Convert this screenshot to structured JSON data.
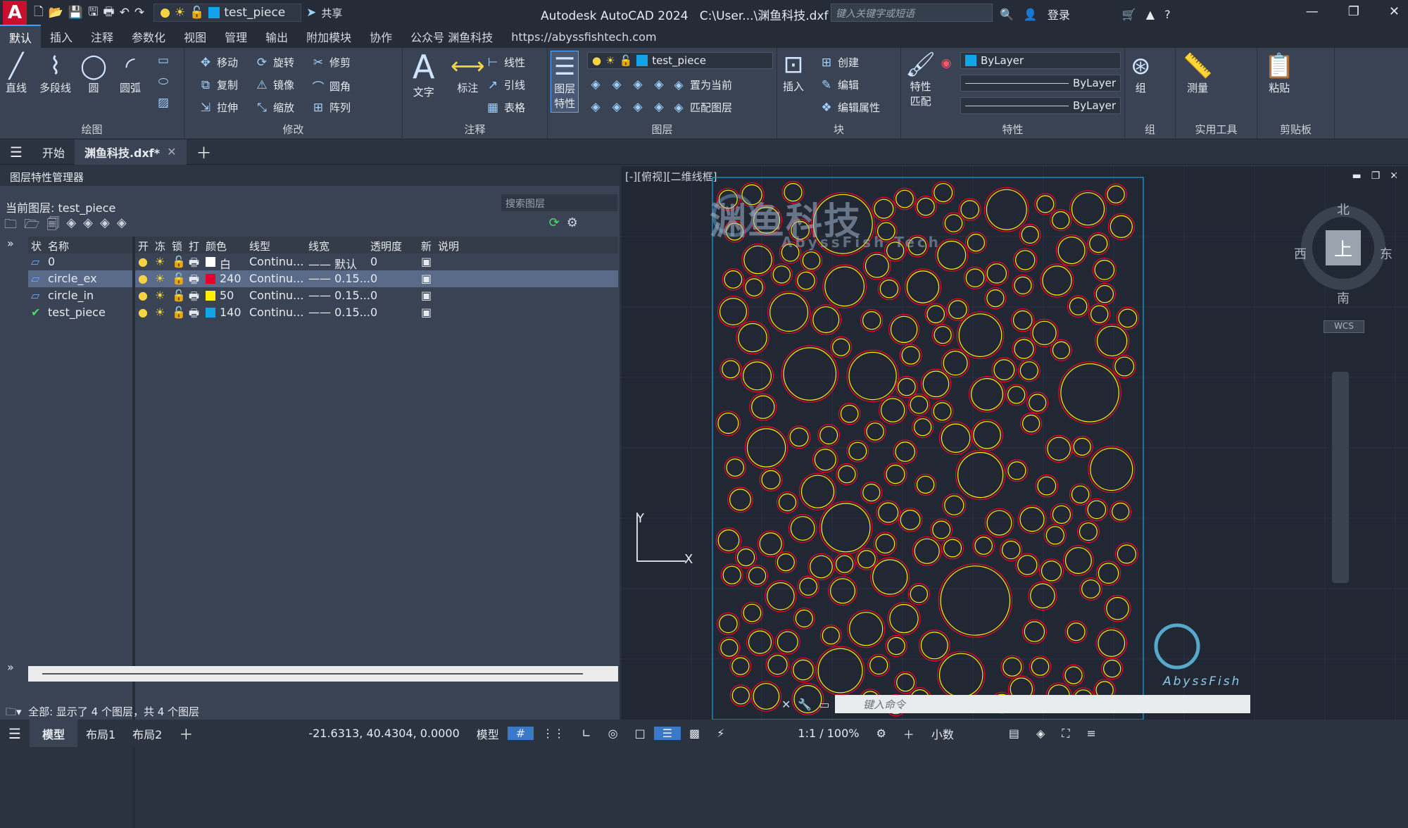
{
  "app": {
    "logo": "A",
    "title": "Autodesk AutoCAD 2024",
    "file_path": "C:\\User...\\渊鱼科技.dxf",
    "search_placeholder": "键入关键字或短语",
    "login": "登录",
    "share": "共享"
  },
  "quick_access": {
    "layer": "test_piece",
    "layer_color": "#12a4e8"
  },
  "menu": [
    "默认",
    "插入",
    "注释",
    "参数化",
    "视图",
    "管理",
    "输出",
    "附加模块",
    "协作",
    "公众号 渊鱼科技",
    "https://abyssfishtech.com"
  ],
  "ribbon": {
    "draw": {
      "title": "绘图",
      "line": "直线",
      "polyline": "多段线",
      "circle": "圆",
      "arc": "圆弧"
    },
    "modify": {
      "title": "修改",
      "move": "移动",
      "rotate": "旋转",
      "trim": "修剪",
      "copy": "复制",
      "mirror": "镜像",
      "fillet": "圆角",
      "stretch": "拉伸",
      "scale": "缩放",
      "array": "阵列"
    },
    "annotation": {
      "title": "注释",
      "text": "文字",
      "dimension": "标注",
      "linear": "线性",
      "leader": "引线",
      "table": "表格"
    },
    "layers": {
      "title": "图层",
      "props_line1": "图层",
      "props_line2": "特性",
      "current_layer": "test_piece",
      "set_current": "置为当前",
      "match_layer": "匹配图层"
    },
    "block": {
      "title": "块",
      "insert": "插入",
      "create": "创建",
      "edit": "编辑",
      "edit_attr": "编辑属性"
    },
    "properties": {
      "title": "特性",
      "match_line1": "特性",
      "match_line2": "匹配",
      "color": "ByLayer",
      "linetype": "ByLayer",
      "lineweight": "ByLayer"
    },
    "groups": {
      "title": "组",
      "group": "组"
    },
    "utilities": {
      "title": "实用工具",
      "measure": "测量"
    },
    "clipboard": {
      "title": "剪贴板",
      "paste": "粘贴"
    }
  },
  "doc_tabs": {
    "start": "开始",
    "file": "渊鱼科技.dxf*"
  },
  "layer_manager": {
    "title": "图层特性管理器",
    "current": "当前图层: test_piece",
    "search_placeholder": "搜索图层",
    "columns": [
      "状",
      "名称",
      "开",
      "冻",
      "锁",
      "打",
      "颜色",
      "线型",
      "线宽",
      "透明度",
      "新",
      "说明"
    ],
    "rows": [
      {
        "name": "0",
        "color_name": "白",
        "color": "#ffffff",
        "linetype": "Continu...",
        "lineweight": "默认",
        "transparency": "0",
        "selected": false,
        "current": false
      },
      {
        "name": "circle_ex",
        "color_name": "240",
        "color": "#e8002a",
        "linetype": "Continu...",
        "lineweight": "0.15...",
        "transparency": "0",
        "selected": true,
        "current": false
      },
      {
        "name": "circle_in",
        "color_name": "50",
        "color": "#ffee00",
        "linetype": "Continu...",
        "lineweight": "0.15...",
        "transparency": "0",
        "selected": false,
        "current": false
      },
      {
        "name": "test_piece",
        "color_name": "140",
        "color": "#12a4e8",
        "linetype": "Continu...",
        "lineweight": "0.15...",
        "transparency": "0",
        "selected": false,
        "current": true
      }
    ],
    "footer": "全部: 显示了 4 个图层，共 4 个图层"
  },
  "viewport": {
    "label": "[-][俯视][二维线框]",
    "watermark_cn": "渊鱼科技",
    "watermark_en": "AbyssFish Tech",
    "logo_text": "AbyssFish",
    "compass": {
      "n": "北",
      "s": "南",
      "e": "东",
      "w": "西",
      "top": "上"
    },
    "wcs": "WCS",
    "axis_x": "X",
    "axis_y": "Y",
    "cmd_placeholder": "键入命令"
  },
  "status": {
    "model_tab": "模型",
    "layout1": "布局1",
    "layout2": "布局2",
    "coords": "-21.6313, 40.4304, 0.0000",
    "space": "模型",
    "scale": "1:1 / 100%",
    "units": "小数"
  }
}
